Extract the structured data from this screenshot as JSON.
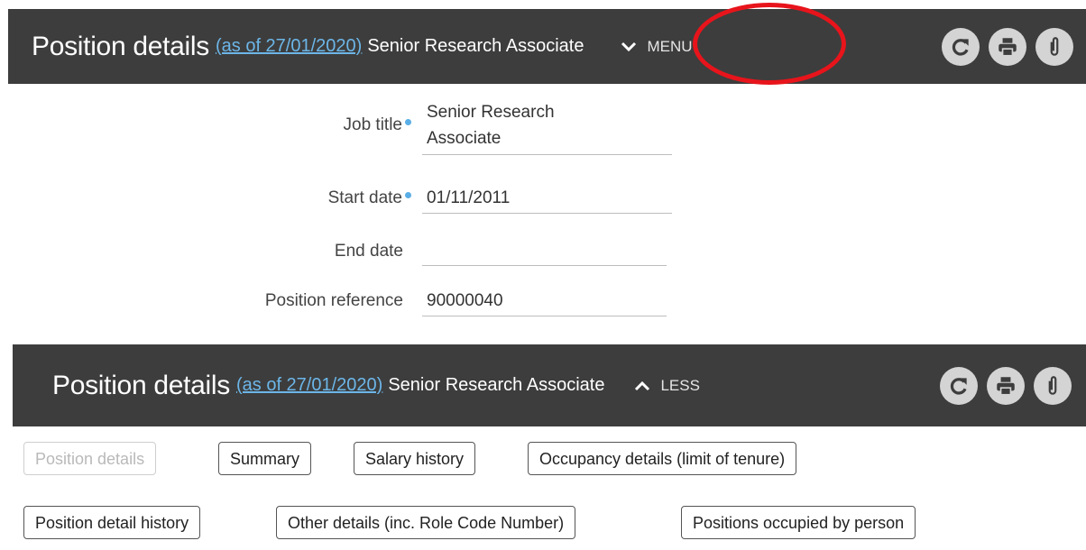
{
  "header_collapsed": {
    "title": "Position details",
    "as_of": "(as of 27/01/2020)",
    "subtitle": "Senior Research Associate",
    "toggle_label": "MENU",
    "toggle_icon": "chevron-down-icon"
  },
  "form": {
    "job_title_label": "Job title",
    "job_title_line1": "Senior Research",
    "job_title_line2": "Associate",
    "start_date_label": "Start date",
    "start_date_value": "01/11/2011",
    "end_date_label": "End date",
    "end_date_value": "",
    "position_ref_label": "Position reference",
    "position_ref_value": "90000040"
  },
  "header_expanded": {
    "title": "Position details",
    "as_of": "(as of 27/01/2020)",
    "subtitle": "Senior Research Associate",
    "toggle_label": "LESS",
    "toggle_icon": "chevron-up-icon"
  },
  "tabs": [
    {
      "label": "Position details",
      "disabled": true
    },
    {
      "label": "Summary"
    },
    {
      "label": "Salary history"
    },
    {
      "label": "Occupancy details (limit of tenure)"
    },
    {
      "label": "Position detail history"
    },
    {
      "label": "Other details (inc. Role Code Number)"
    },
    {
      "label": "Positions occupied by person"
    }
  ],
  "icons": [
    "refresh-icon",
    "print-icon",
    "attachment-icon"
  ],
  "colors": {
    "bar": "#3d3d3d",
    "link": "#6cb6e8",
    "required_dot": "#5aaee6",
    "highlight": "#e8141b"
  }
}
